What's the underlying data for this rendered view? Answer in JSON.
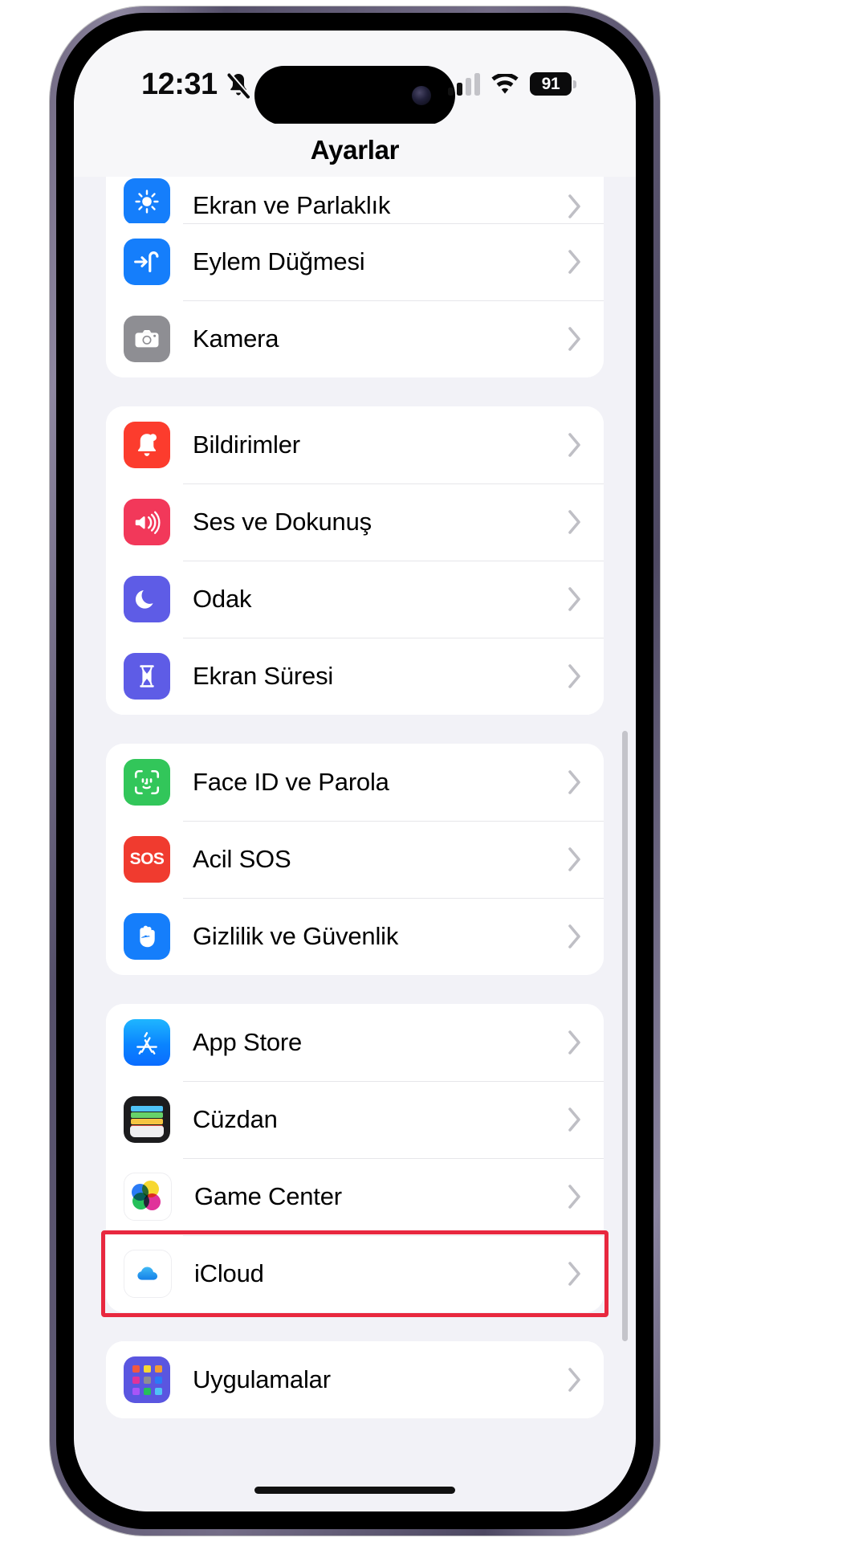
{
  "status_bar": {
    "time": "12:31",
    "silent_icon": "bell-slash-icon",
    "cellular_icon": "cellular-signal-icon",
    "cellular_bars_active": 2,
    "cellular_bars_total": 4,
    "wifi_icon": "wifi-icon",
    "battery_percent": "91",
    "battery_icon": "battery-icon"
  },
  "nav": {
    "title": "Ayarlar"
  },
  "groups": [
    {
      "id": "group-display",
      "rows": [
        {
          "label": "Ekran ve Parlaklık",
          "icon": "brightness-icon",
          "icon_class": "ic-display",
          "clipped": true,
          "chevron": "chevron-right-icon"
        },
        {
          "label": "Eylem Düğmesi",
          "icon": "action-button-icon",
          "icon_class": "ic-action",
          "clipped": false,
          "chevron": "chevron-right-icon"
        },
        {
          "label": "Kamera",
          "icon": "camera-icon",
          "icon_class": "ic-camera",
          "clipped": false,
          "chevron": "chevron-right-icon"
        }
      ]
    },
    {
      "id": "group-notifications",
      "rows": [
        {
          "label": "Bildirimler",
          "icon": "bell-icon",
          "icon_class": "ic-notif",
          "clipped": false,
          "chevron": "chevron-right-icon"
        },
        {
          "label": "Ses ve Dokunuş",
          "icon": "speaker-icon",
          "icon_class": "ic-sound",
          "clipped": false,
          "chevron": "chevron-right-icon"
        },
        {
          "label": "Odak",
          "icon": "moon-icon",
          "icon_class": "ic-focus",
          "clipped": false,
          "chevron": "chevron-right-icon"
        },
        {
          "label": "Ekran Süresi",
          "icon": "hourglass-icon",
          "icon_class": "ic-screentime",
          "clipped": false,
          "chevron": "chevron-right-icon"
        }
      ]
    },
    {
      "id": "group-security",
      "rows": [
        {
          "label": "Face ID ve Parola",
          "icon": "face-id-icon",
          "icon_class": "ic-faceid",
          "clipped": false,
          "chevron": "chevron-right-icon"
        },
        {
          "label": "Acil SOS",
          "icon": "sos-icon",
          "icon_class": "ic-sos",
          "clipped": false,
          "chevron": "chevron-right-icon"
        },
        {
          "label": "Gizlilik ve Güvenlik",
          "icon": "hand-raised-icon",
          "icon_class": "ic-privacy",
          "clipped": false,
          "chevron": "chevron-right-icon"
        }
      ]
    },
    {
      "id": "group-services",
      "rows": [
        {
          "label": "App Store",
          "icon": "app-store-icon",
          "icon_class": "ic-appstore",
          "clipped": false,
          "chevron": "chevron-right-icon"
        },
        {
          "label": "Cüzdan",
          "icon": "wallet-icon",
          "icon_class": "ic-wallet",
          "clipped": false,
          "chevron": "chevron-right-icon"
        },
        {
          "label": "Game Center",
          "icon": "game-center-icon",
          "icon_class": "ic-gamecenter",
          "clipped": false,
          "chevron": "chevron-right-icon"
        },
        {
          "label": "iCloud",
          "icon": "icloud-icon",
          "icon_class": "ic-icloud",
          "clipped": false,
          "chevron": "chevron-right-icon",
          "highlighted": true
        }
      ]
    },
    {
      "id": "group-apps",
      "rows": [
        {
          "label": "Uygulamalar",
          "icon": "apps-grid-icon",
          "icon_class": "ic-apps",
          "clipped": false,
          "chevron": "chevron-right-icon"
        }
      ]
    }
  ],
  "annotation": {
    "target_row_label": "iCloud",
    "color": "#e8283f"
  },
  "sos_badge_text": "SOS"
}
